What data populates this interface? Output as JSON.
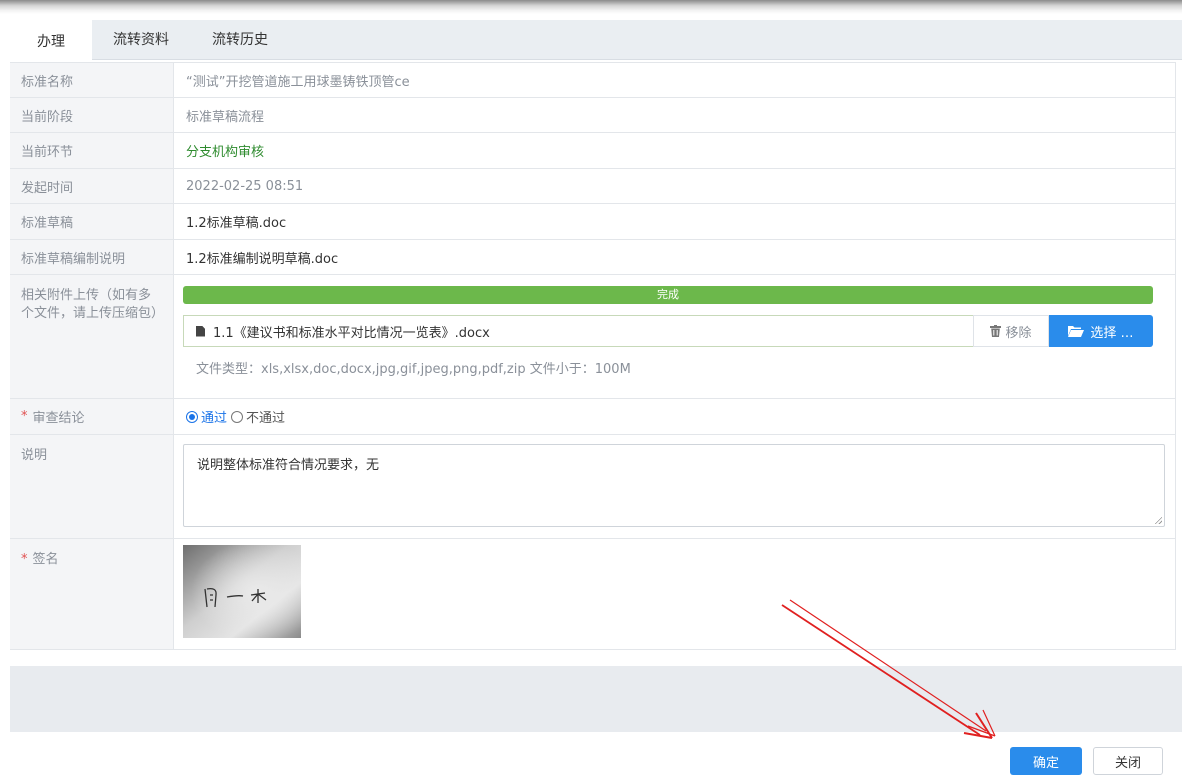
{
  "tabs": [
    {
      "label": "办理",
      "active": true
    },
    {
      "label": "流转资料",
      "active": false
    },
    {
      "label": "流转历史",
      "active": false
    }
  ],
  "fields": {
    "standard_name": {
      "label": "标准名称",
      "value": "“测试”开挖管道施工用球墨铸铁顶管ce"
    },
    "current_stage": {
      "label": "当前阶段",
      "value": "标准草稿流程"
    },
    "current_step": {
      "label": "当前环节",
      "value": "分支机构审核"
    },
    "start_time": {
      "label": "发起时间",
      "value": "2022-02-25 08:51"
    },
    "draft": {
      "label": "标准草稿",
      "value": "1.2标准草稿.doc"
    },
    "draft_note": {
      "label": "标准草稿编制说明",
      "value": "1.2标准编制说明草稿.doc"
    }
  },
  "attachment": {
    "label": "相关附件上传（如有多个文件，请上传压缩包）",
    "progress_text": "完成",
    "progress": 1.0,
    "file_name": "1.1《建议书和标准水平对比情况一览表》.docx",
    "remove_label": "移除",
    "select_label": "选择 …",
    "file_types_text": "文件类型：xls,xlsx,doc,docx,jpg,gif,jpeg,png,pdf,zip  文件小于：100M"
  },
  "review": {
    "required_mark": "*",
    "label": "审查结论",
    "option_pass": "通过",
    "option_fail": "不通过",
    "selected": "通过"
  },
  "note": {
    "label": "说明",
    "value": "说明整体标准符合情况要求，无"
  },
  "signature": {
    "required_mark": "*",
    "label": "签名",
    "handwriting": "周一木"
  },
  "buttons": {
    "ok": "确定",
    "close": "关闭"
  },
  "colors": {
    "primary": "#2a8ceb",
    "progress": "#6cb84b",
    "step_green": "#2e8b2e",
    "required": "#e05050",
    "annotation_arrow": "#e02020"
  },
  "icons": {
    "file": "file-icon",
    "remove": "trash-icon",
    "select": "folder-open-icon"
  }
}
